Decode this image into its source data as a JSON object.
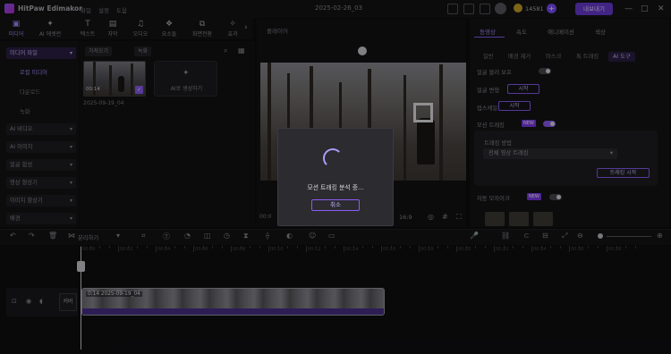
{
  "titlebar": {
    "app_title": "HitPaw Edimakor",
    "menus": [
      "파일",
      "설정",
      "도움"
    ],
    "document_title": "2025-02-26_03",
    "credits": "14581",
    "export_label": "내보내기",
    "icons": [
      "calendar-icon",
      "message-icon",
      "gift-icon",
      "avatar",
      "coin-icon",
      "plus-icon",
      "minimize-icon",
      "maximize-icon",
      "close-icon"
    ]
  },
  "toolbar": {
    "items": [
      {
        "label": "미디어",
        "icon": "media-icon",
        "active": true
      },
      {
        "label": "AI 에셋런",
        "icon": "ai-icon",
        "active": false
      },
      {
        "label": "텍스트",
        "icon": "text-icon",
        "active": false
      },
      {
        "label": "자막",
        "icon": "subtitle-icon",
        "active": false
      },
      {
        "label": "오디오",
        "icon": "audio-icon",
        "active": false
      },
      {
        "label": "요소들",
        "icon": "elements-icon",
        "active": false
      },
      {
        "label": "화면전환",
        "icon": "transition-icon",
        "active": false
      },
      {
        "label": "효과",
        "icon": "effect-icon",
        "active": false
      }
    ],
    "more_icon": "chevron-right-icon"
  },
  "sidebar": {
    "sections": [
      {
        "label": "미디어 파일",
        "active": true,
        "subitems": [
          {
            "label": "로컬 미디어",
            "active": true
          },
          {
            "label": "다운로드",
            "active": false
          },
          {
            "label": "녹화",
            "active": false
          }
        ]
      },
      {
        "label": "AI 비디오",
        "active": false
      },
      {
        "label": "AI 이미지",
        "active": false
      },
      {
        "label": "얼굴 합성",
        "active": false
      },
      {
        "label": "영상 향상기",
        "active": false
      },
      {
        "label": "이미지 향상기",
        "active": false
      },
      {
        "label": "배경",
        "active": false
      }
    ]
  },
  "media": {
    "filter_chips": [
      "가져오기",
      "녹화"
    ],
    "items": [
      {
        "duration": "00:14",
        "name": "2025-09-19_04",
        "selected": true
      }
    ],
    "ai_generate_label": "AI로 생성하기"
  },
  "player": {
    "label": "플레이어",
    "timecode": "00:0",
    "ratio": "16:9"
  },
  "dialog": {
    "message": "모션 트래킹 분석 중...",
    "cancel_label": "취소"
  },
  "right_panel": {
    "tabs": [
      "동영상",
      "속도",
      "애니메이션",
      "색상"
    ],
    "active_tab": "동영상",
    "subtabs": [
      "일반",
      "배경 제거",
      "마스크",
      "톡 트래킹",
      "AI 도구"
    ],
    "active_subtab": "AI 도구",
    "rows": [
      {
        "label": "얼굴 블러 보호",
        "control": "toggle",
        "on": false
      },
      {
        "label": "얼굴 변형",
        "control": "button",
        "button_label": "시작"
      },
      {
        "label": "업스케일",
        "control": "button",
        "button_label": "시작"
      },
      {
        "label": "모션 트래킹",
        "control": "toggle",
        "on": true,
        "badge": "NEW"
      },
      {
        "label": "자동 모자이크",
        "control": "toggle",
        "on": false,
        "badge": "NEW"
      }
    ],
    "tracking": {
      "label": "트래킹 방법",
      "select_value": "전체 영상 트래킹",
      "start_label": "트래킹 시작"
    }
  },
  "timeline": {
    "tools": [
      "undo-icon",
      "redo-icon",
      "delete-icon",
      "split-icon",
      "crop-icon",
      "speed-icon",
      "mask-icon",
      "freeze-icon",
      "audio-icon",
      "mirror-icon",
      "rotate-icon",
      "color-icon",
      "face-icon",
      "caption-icon"
    ],
    "split_label": "분리하기",
    "ruler_labels": [
      "00:00",
      "00:02",
      "00:04",
      "00:06",
      "00:08",
      "00:10",
      "00:12",
      "00:14",
      "00:16",
      "00:18",
      "00:20",
      "00:22",
      "00:24",
      "00:26",
      "00:28"
    ],
    "cover_label": "커버",
    "clip_label": "0:14 2025-09-19_04"
  }
}
